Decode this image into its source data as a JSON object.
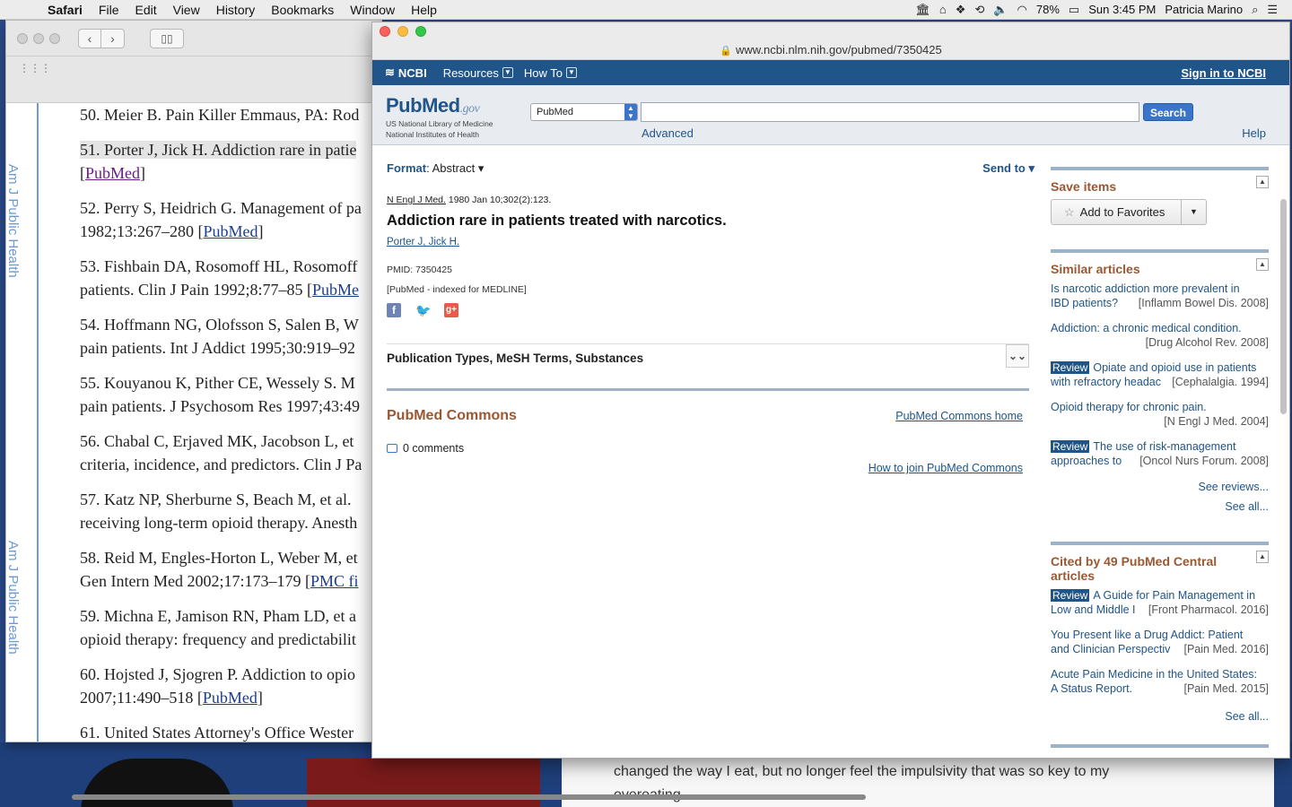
{
  "menubar": {
    "app": "Safari",
    "items": [
      "File",
      "Edit",
      "View",
      "History",
      "Bookmarks",
      "Window",
      "Help"
    ],
    "battery": "78%",
    "clock": "Sun 3:45 PM",
    "user": "Patricia Marino"
  },
  "back_window": {
    "sidebar_label": "Am J Public Health",
    "refs": [
      {
        "text": "50. Meier B. Pain Killer Emmaus, PA: Rod",
        "line2": "",
        "link": ""
      },
      {
        "text": "51. Porter J, Jick H. Addiction rare in patie",
        "line2_pre": "[",
        "link": "PubMed",
        "line2_post": "]"
      },
      {
        "text": "52. Perry S, Heidrich G. Management of pa",
        "line2_pre": "1982;13:267–280 [",
        "link": "PubMed",
        "line2_post": "]"
      },
      {
        "text": "53. Fishbain DA, Rosomoff HL, Rosomoff",
        "line2_pre": "patients. Clin J Pain 1992;8:77–85 [",
        "link": "PubMe",
        "line2_post": ""
      },
      {
        "text": "54. Hoffmann NG, Olofsson S, Salen B, W",
        "line2_pre": "pain patients. Int J Addict 1995;30:919–92",
        "link": "",
        "line2_post": ""
      },
      {
        "text": "55. Kouyanou K, Pither CE, Wessely S. M",
        "line2_pre": "pain patients. J Psychosom Res 1997;43:49",
        "link": "",
        "line2_post": ""
      },
      {
        "text": "56. Chabal C, Erjaved MK, Jacobson L, et",
        "line2_pre": "criteria, incidence, and predictors. Clin J Pa",
        "link": "",
        "line2_post": ""
      },
      {
        "text": "57. Katz NP, Sherburne S, Beach M, et al.",
        "line2_pre": "receiving long-term opioid therapy. Anesth",
        "link": "",
        "line2_post": ""
      },
      {
        "text": "58. Reid M, Engles-Horton L, Weber M, et",
        "line2_pre": "Gen Intern Med 2002;17:173–179 [",
        "link": "PMC fi",
        "line2_post": ""
      },
      {
        "text": "59. Michna E, Jamison RN, Pham LD, et a",
        "line2_pre": "opioid therapy: frequency and predictabilit",
        "link": "",
        "line2_post": ""
      },
      {
        "text": "60. Hojsted J, Sjogren P. Addiction to opio",
        "line2_pre": "2007;11:490–518 [",
        "link": "PubMed",
        "line2_post": "]"
      },
      {
        "text": "61. United States Attorney's Office Wester",
        "line2_pre": "",
        "link": "",
        "line2_post": ""
      }
    ]
  },
  "desktop": {
    "article_text_1": "changed the way I eat, but no longer feel the impulsivity that was so key to my",
    "article_text_2": "overeating."
  },
  "front_window": {
    "url": "www.ncbi.nlm.nih.gov/pubmed/7350425",
    "ncbi_bar": {
      "logo": "NCBI",
      "resources": "Resources",
      "howto": "How To",
      "signin": "Sign in to NCBI"
    },
    "search": {
      "logo_main_a": "Pub",
      "logo_main_b": "Med",
      "logo_gov": ".gov",
      "logo_sub1": "US National Library of Medicine",
      "logo_sub2": "National Institutes of Health",
      "database": "PubMed",
      "query": "",
      "search_label": "Search",
      "advanced": "Advanced",
      "help": "Help"
    },
    "article": {
      "format_label": "Format",
      "format_value": "Abstract",
      "send_to": "Send to",
      "journal": "N Engl J Med.",
      "citation": "1980 Jan 10;302(2):123.",
      "title": "Addiction rare in patients treated with narcotics.",
      "author1": "Porter J",
      "author2": "Jick H",
      "pmid": "PMID: 7350425",
      "indexed": "[PubMed - indexed for MEDLINE]",
      "pub_types": "Publication Types, MeSH Terms, Substances",
      "commons_title": "PubMed Commons",
      "commons_home": "PubMed Commons home",
      "comments": "0 comments",
      "join": "How to join PubMed Commons"
    },
    "sidebar": {
      "save_title": "Save items",
      "add_fav": "Add to Favorites",
      "similar_title": "Similar articles",
      "similar": [
        {
          "review": "",
          "l1": "Is narcotic addiction more prevalent in",
          "l2a": "IBD patients?",
          "src": "[Inflamm Bowel Dis. 2008]"
        },
        {
          "review": "",
          "l1": "Addiction: a chronic medical condition.",
          "l2a": "",
          "src": "[Drug Alcohol Rev. 2008]"
        },
        {
          "review": "Review",
          "l1": "Opiate and opioid use in patients",
          "l2a": "with refractory headac",
          "src": "[Cephalalgia. 1994]"
        },
        {
          "review": "",
          "l1": "Opioid therapy for chronic pain.",
          "l2a": "",
          "src": "[N Engl J Med. 2004]"
        },
        {
          "review": "Review",
          "l1": "The use of risk-management",
          "l2a": "approaches to",
          "src": "[Oncol Nurs Forum. 2008]"
        }
      ],
      "see_reviews": "See reviews...",
      "see_all": "See all...",
      "cited_title": "Cited by 49 PubMed Central articles",
      "cited": [
        {
          "review": "Review",
          "l1": "A Guide for Pain Management in",
          "l2a": "Low and Middle I",
          "src": "[Front Pharmacol. 2016]"
        },
        {
          "review": "",
          "l1": "You Present like a Drug Addict: Patient",
          "l2a": "and Clinician Perspectiv",
          "src": "[Pain Med. 2016]"
        },
        {
          "review": "",
          "l1": "Acute Pain Medicine in the United States:",
          "l2a": "A Status Report.",
          "src": "[Pain Med. 2015]"
        }
      ],
      "see_all_2": "See all..."
    }
  }
}
